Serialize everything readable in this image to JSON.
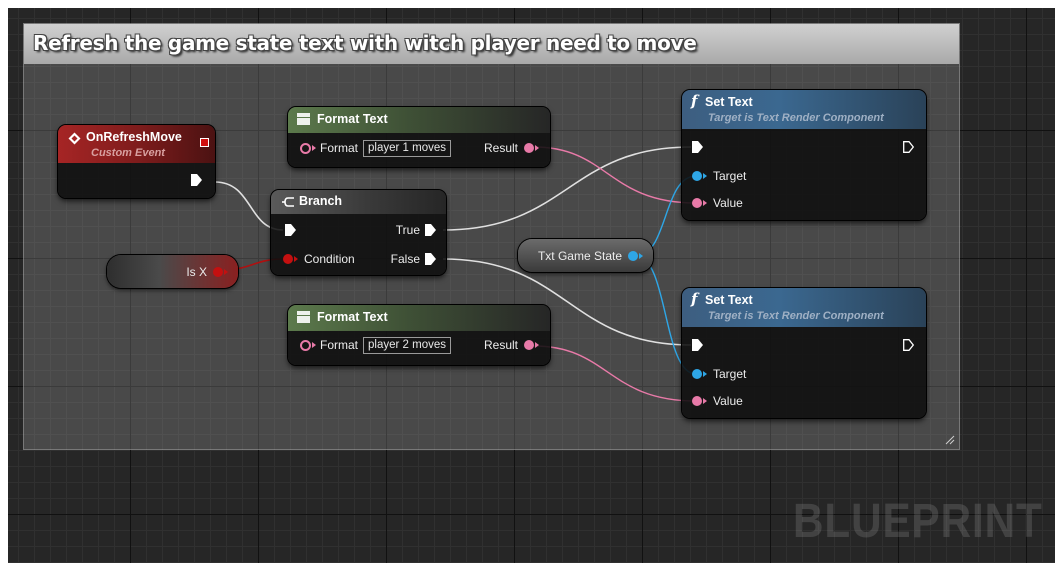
{
  "comment": {
    "title": "Refresh the game state text with witch player need to move"
  },
  "nodes": {
    "on_refresh_move": {
      "title": "OnRefreshMove",
      "subtitle": "Custom Event"
    },
    "format_text_1": {
      "title": "Format Text",
      "format_label": "Format",
      "format_value": "player 1 moves",
      "result_label": "Result"
    },
    "format_text_2": {
      "title": "Format Text",
      "format_label": "Format",
      "format_value": "player 2 moves",
      "result_label": "Result"
    },
    "branch": {
      "title": "Branch",
      "true_label": "True",
      "false_label": "False",
      "condition_label": "Condition"
    },
    "is_x": {
      "label": "Is X"
    },
    "txt_game_state": {
      "label": "Txt Game State"
    },
    "set_text_1": {
      "title": "Set Text",
      "subtitle": "Target is Text Render Component",
      "target_label": "Target",
      "value_label": "Value"
    },
    "set_text_2": {
      "title": "Set Text",
      "subtitle": "Target is Text Render Component",
      "target_label": "Target",
      "value_label": "Value"
    }
  },
  "watermark": "BLUEPRINT",
  "colors": {
    "exec_wire": "#e0e0e0",
    "text_pin": "#e87aa8",
    "object_pin": "#2ea6e6",
    "bool_pin": "#c41010",
    "function_header": "#3b6890",
    "event_header": "#a62525",
    "pure_header": "#5c7a4c"
  }
}
